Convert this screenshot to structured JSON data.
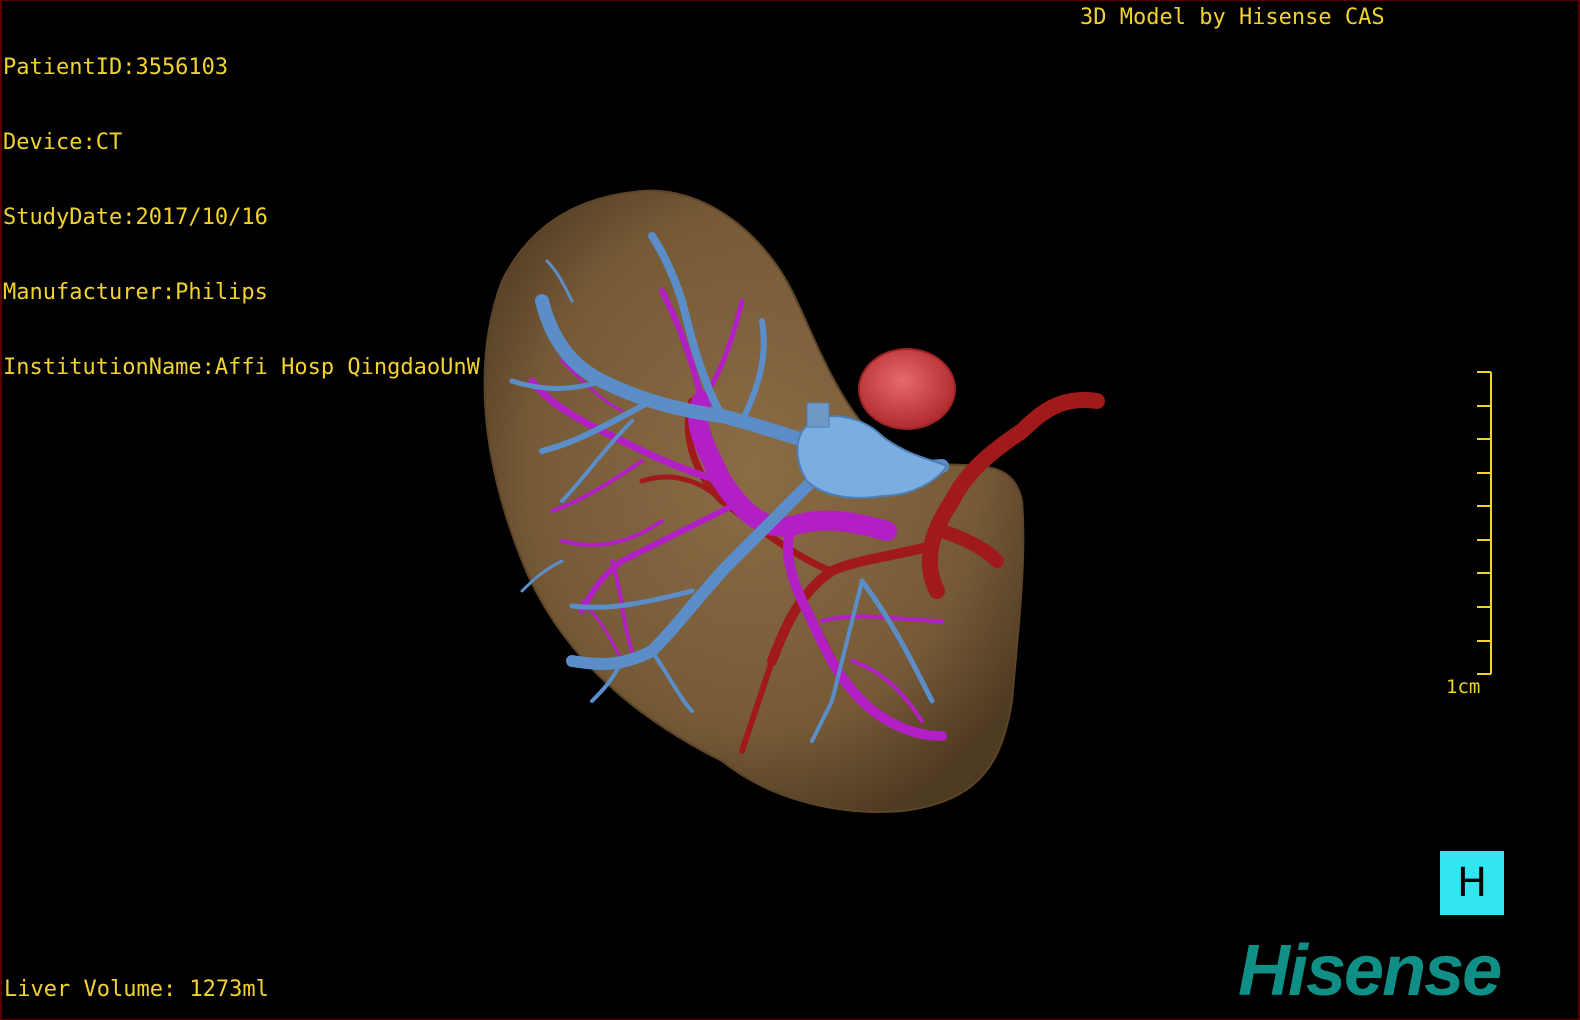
{
  "patient_info": {
    "patient_id": "PatientID:3556103",
    "device": "Device:CT",
    "study_date": "StudyDate:2017/10/16",
    "manufacturer": "Manufacturer:Philips",
    "institution": "InstitutionName:Affi Hosp QingdaoUnW"
  },
  "title": "3D Model by Hisense CAS",
  "liver_volume": "Liver Volume: 1273ml",
  "scale_bar": {
    "label": "1cm"
  },
  "orientation": {
    "label": "H"
  },
  "brand": {
    "logo_text": "Hisense"
  },
  "colors": {
    "text": "#f2d22e",
    "liver": "#7a5e3a",
    "hepatic_vein": "#5b8ec9",
    "portal_vein": "#b21fc4",
    "hepatic_artery": "#a01a1a",
    "tumor": "#d8454a",
    "orientation_box": "#33e5ee",
    "brand": "#0f8f86"
  }
}
